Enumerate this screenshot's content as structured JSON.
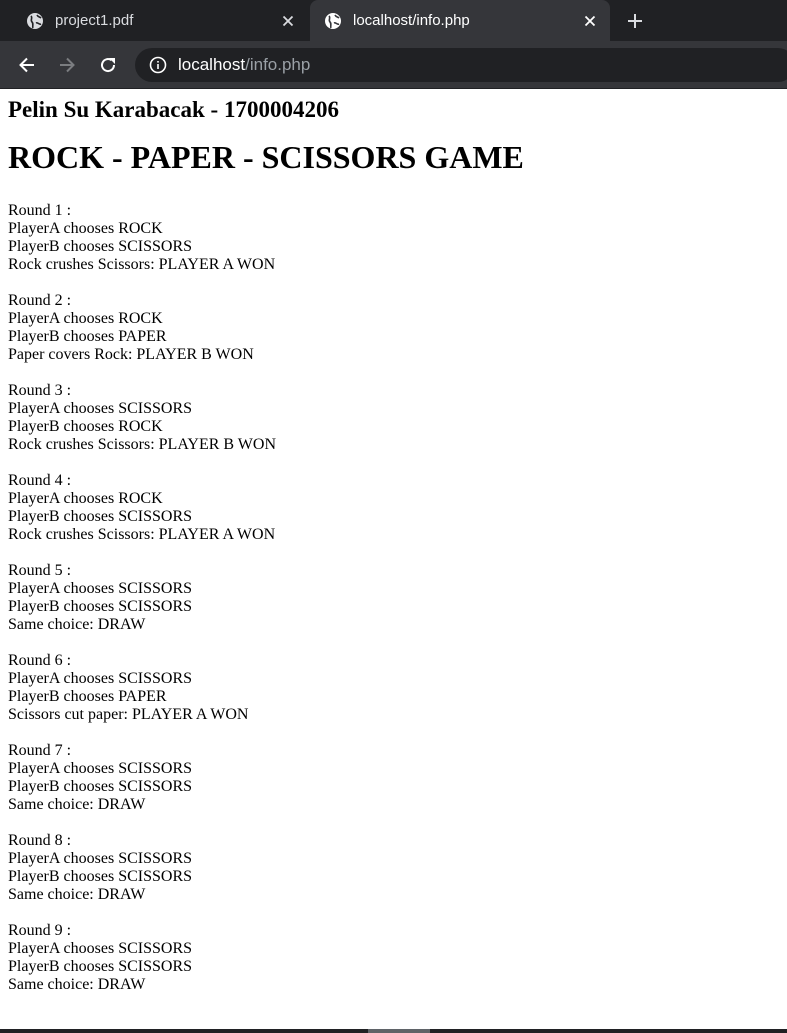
{
  "browser": {
    "tabs": [
      {
        "title": "project1.pdf",
        "active": false
      },
      {
        "title": "localhost/info.php",
        "active": true
      }
    ],
    "address": {
      "host": "localhost",
      "path": "/info.php"
    },
    "icons": {
      "tab_icon": "globe-icon",
      "close": "close-icon",
      "new_tab": "plus-icon",
      "back": "back-arrow-icon",
      "forward": "forward-arrow-icon",
      "reload": "reload-icon",
      "site_info": "info-icon"
    },
    "colors": {
      "tabstrip": "#202124",
      "toolbar": "#35363a",
      "omnibox": "#202124"
    }
  },
  "page": {
    "author": "Pelin Su Karabacak - 1700004206",
    "title": "ROCK - PAPER - SCISSORS GAME",
    "rounds": [
      {
        "heading": "Round 1 :",
        "player_a": "PlayerA chooses ROCK",
        "player_b": "PlayerB chooses SCISSORS",
        "result": "Rock crushes Scissors: PLAYER A WON"
      },
      {
        "heading": "Round 2 :",
        "player_a": "PlayerA chooses ROCK",
        "player_b": "PlayerB chooses PAPER",
        "result": "Paper covers Rock: PLAYER B WON"
      },
      {
        "heading": "Round 3 :",
        "player_a": "PlayerA chooses SCISSORS",
        "player_b": "PlayerB chooses ROCK",
        "result": "Rock crushes Scissors: PLAYER B WON"
      },
      {
        "heading": "Round 4 :",
        "player_a": "PlayerA chooses ROCK",
        "player_b": "PlayerB chooses SCISSORS",
        "result": "Rock crushes Scissors: PLAYER A WON"
      },
      {
        "heading": "Round 5 :",
        "player_a": "PlayerA chooses SCISSORS",
        "player_b": "PlayerB chooses SCISSORS",
        "result": "Same choice: DRAW"
      },
      {
        "heading": "Round 6 :",
        "player_a": "PlayerA chooses SCISSORS",
        "player_b": "PlayerB chooses PAPER",
        "result": "Scissors cut paper: PLAYER A WON"
      },
      {
        "heading": "Round 7 :",
        "player_a": "PlayerA chooses SCISSORS",
        "player_b": "PlayerB chooses SCISSORS",
        "result": "Same choice: DRAW"
      },
      {
        "heading": "Round 8 :",
        "player_a": "PlayerA chooses SCISSORS",
        "player_b": "PlayerB chooses SCISSORS",
        "result": "Same choice: DRAW"
      },
      {
        "heading": "Round 9 :",
        "player_a": "PlayerA chooses SCISSORS",
        "player_b": "PlayerB chooses SCISSORS",
        "result": "Same choice: DRAW"
      }
    ]
  }
}
